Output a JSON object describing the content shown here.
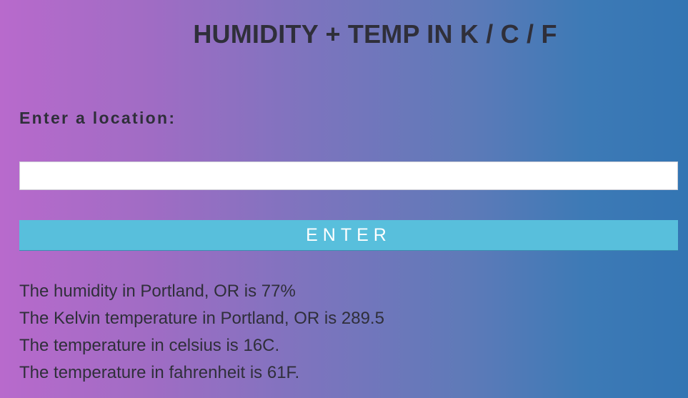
{
  "header": {
    "title": "HUMIDITY + TEMP IN K / C / F"
  },
  "form": {
    "location_label": "Enter a location:",
    "location_value": "",
    "enter_label": "ENTER"
  },
  "results": {
    "humidity": "The humidity in Portland, OR is 77%",
    "kelvin": "The Kelvin temperature in Portland, OR is 289.5",
    "celsius": "The temperature in celsius is 16C.",
    "fahrenheit": "The temperature in fahrenheit is 61F."
  },
  "colors": {
    "gradient_start": "#b86acc",
    "gradient_end": "#3375b3",
    "button": "#58bfdc",
    "text": "#2f2f3a"
  }
}
